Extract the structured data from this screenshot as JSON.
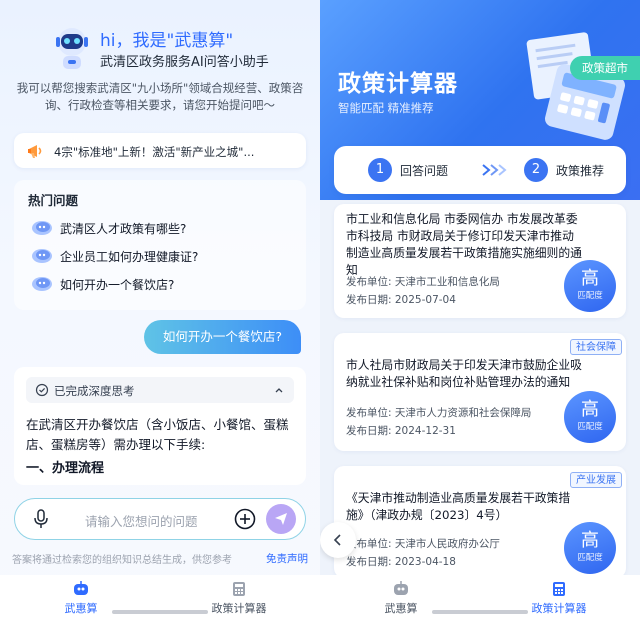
{
  "left": {
    "greeting": "hi，我是\"武惠算\"",
    "subtitle": "武清区政务服务AI问答小助手",
    "intro": "我可以帮您搜索武清区\"九小场所\"领域合规经营、政策咨询、行政检查等相关要求，请您开始提问吧～",
    "news": "4宗\"标准地\"上新！激活\"新产业之城\"...",
    "hot_title": "热门问题",
    "hot_questions": [
      "武清区人才政策有哪些?",
      "企业员工如何办理健康证?",
      "如何开办一个餐饮店?"
    ],
    "user_question": "如何开办一个餐饮店?",
    "think_label": "已完成深度思考",
    "answer_text": "在武清区开办餐饮店（含小饭店、小餐馆、蛋糕店、蛋糕房等）需办理以下手续:",
    "answer_heading": "一、办理流程",
    "input_placeholder": "请输入您想问的问题",
    "disclaimer": "答案将通过检索您的组织知识总结生成，供您参考",
    "disclaimer_link": "免责声明",
    "tabs": [
      "武惠算",
      "政策计算器"
    ]
  },
  "right": {
    "title": "政策计算器",
    "subtitle": "智能匹配 精准推荐",
    "tag": "政策超市",
    "steps": [
      {
        "num": "1",
        "label": "回答问题"
      },
      {
        "num": "2",
        "label": "政策推荐"
      }
    ],
    "cards": [
      {
        "tag": "",
        "title": "市工业和信息化局 市委网信办 市发展改革委 市科技局 市财政局关于修订印发天津市推动制造业高质量发展若干政策措施实施细则的通知",
        "unit": "发布单位:   天津市工业和信息化局",
        "date": "发布日期:   2025-07-04",
        "match": "高",
        "match_label": "匹配度"
      },
      {
        "tag": "社会保障",
        "title": "市人社局市财政局关于印发天津市鼓励企业吸纳就业社保补贴和岗位补贴管理办法的通知",
        "unit": "发布单位:   天津市人力资源和社会保障局",
        "date": "发布日期:   2024-12-31",
        "match": "高",
        "match_label": "匹配度"
      },
      {
        "tag": "产业发展",
        "title": "《天津市推动制造业高质量发展若干政策措施》（津政办规〔2023〕4号）",
        "unit": "发布单位:   天津市人民政府办公厅",
        "date": "发布日期:   2023-04-18",
        "match": "高",
        "match_label": "匹配度"
      }
    ],
    "tabs": [
      "武惠算",
      "政策计算器"
    ]
  },
  "colors": {
    "brand_blue": "#2f6bff",
    "accent_teal": "#3fd0b0",
    "active_tab": "#2f6bff",
    "inactive_tab": "#4b5563"
  },
  "icons": [
    "robot-mascot-icon",
    "megaphone-icon",
    "question-bubble-icon",
    "check-circle-icon",
    "chevron-up-icon",
    "microphone-icon",
    "plus-circle-icon",
    "send-icon",
    "robot-tab-icon",
    "calculator-tab-icon",
    "calculator-illustration",
    "double-chevron-right-icon",
    "chevron-left-icon"
  ]
}
